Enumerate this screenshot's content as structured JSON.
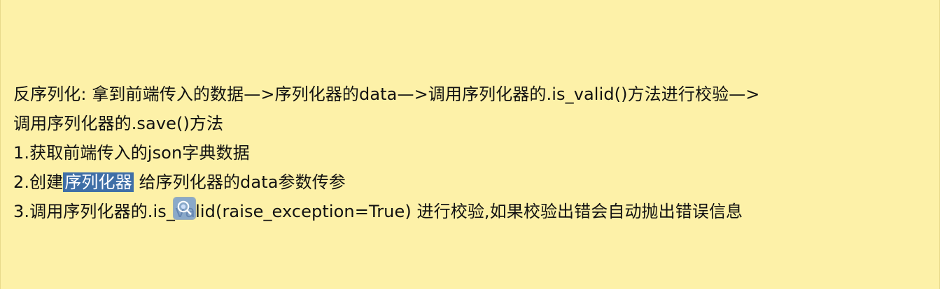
{
  "document": {
    "lines": [
      {
        "text": "反序列化: 拿到前端传入的数据—>序列化器的data—>调用序列化器的.is_valid()方法进行校验—>"
      },
      {
        "text": "调用序列化器的.save()方法"
      },
      {
        "text": "1.获取前端传入的json字典数据"
      },
      {
        "prefix": "2.创建",
        "selected": "序列化器",
        "suffix": " 给序列化器的data参数传参"
      },
      {
        "text": "3.调用序列化器的.is_valid(raise_exception=True) 进行校验,如果校验出错会自动抛出错误信息"
      }
    ]
  },
  "overlay": {
    "icon": "search-icon",
    "color": "#769ccf"
  }
}
